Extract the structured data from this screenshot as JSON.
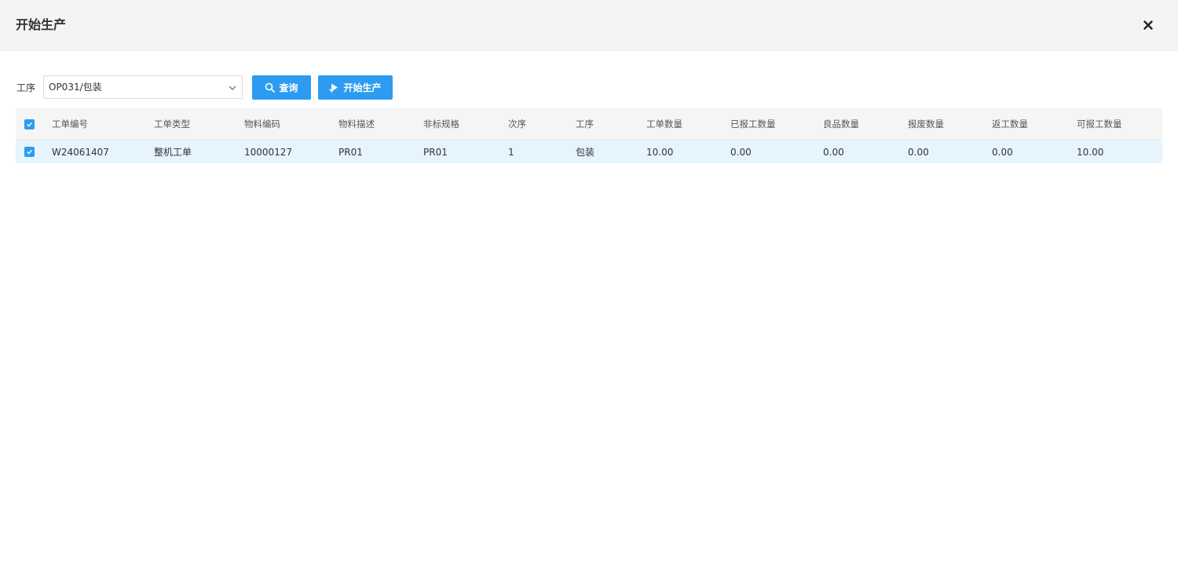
{
  "dialog": {
    "title": "开始生产"
  },
  "filter": {
    "label": "工序",
    "select_value": "OP031/包装"
  },
  "buttons": {
    "query_label": "查询",
    "start_label": "开始生产"
  },
  "table": {
    "columns": [
      "工单编号",
      "工单类型",
      "物料编码",
      "物料描述",
      "非标规格",
      "次序",
      "工序",
      "工单数量",
      "已报工数量",
      "良品数量",
      "报废数量",
      "返工数量",
      "可报工数量"
    ],
    "rows": [
      [
        "W24061407",
        "整机工单",
        "10000127",
        "PR01",
        "PR01",
        "1",
        "包装",
        "10.00",
        "0.00",
        "0.00",
        "0.00",
        "0.00",
        "10.00"
      ]
    ],
    "header_checked": true,
    "row_checked": [
      true
    ]
  },
  "colors": {
    "accent": "#2d9cf0",
    "header_bg": "#f4f4f4",
    "selected_row_bg": "#e6f4fe"
  },
  "icons": {
    "close": "close-icon",
    "chevron": "chevron-down-icon",
    "search": "search-icon",
    "start": "play-icon",
    "check": "check-icon"
  }
}
